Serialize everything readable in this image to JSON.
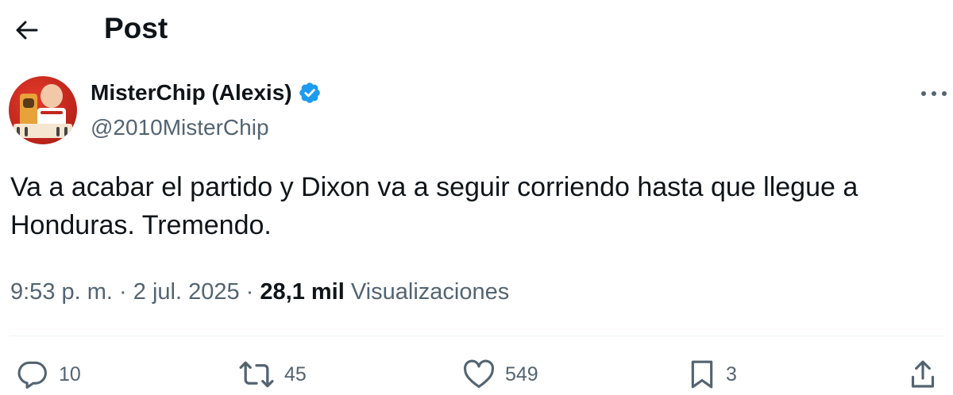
{
  "header": {
    "title": "Post",
    "back_icon": "arrow-left-icon"
  },
  "author": {
    "display_name": "MisterChip (Alexis)",
    "handle": "@2010MisterChip",
    "verified": true,
    "verified_color": "#1d9bf0"
  },
  "post": {
    "text": "Va a acabar el partido y Dixon va a seguir corriendo hasta que llegue a Honduras. Tremendo.",
    "time": "9:53 p. m.",
    "separator": "·",
    "date": "2 jul. 2025",
    "views_count": "28,1 mil",
    "views_label": "Visualizaciones"
  },
  "actions": {
    "replies": "10",
    "reposts": "45",
    "likes": "549",
    "bookmarks": "3"
  },
  "colors": {
    "text_primary": "#0f1419",
    "text_secondary": "#536471",
    "divider": "#eff3f4"
  }
}
